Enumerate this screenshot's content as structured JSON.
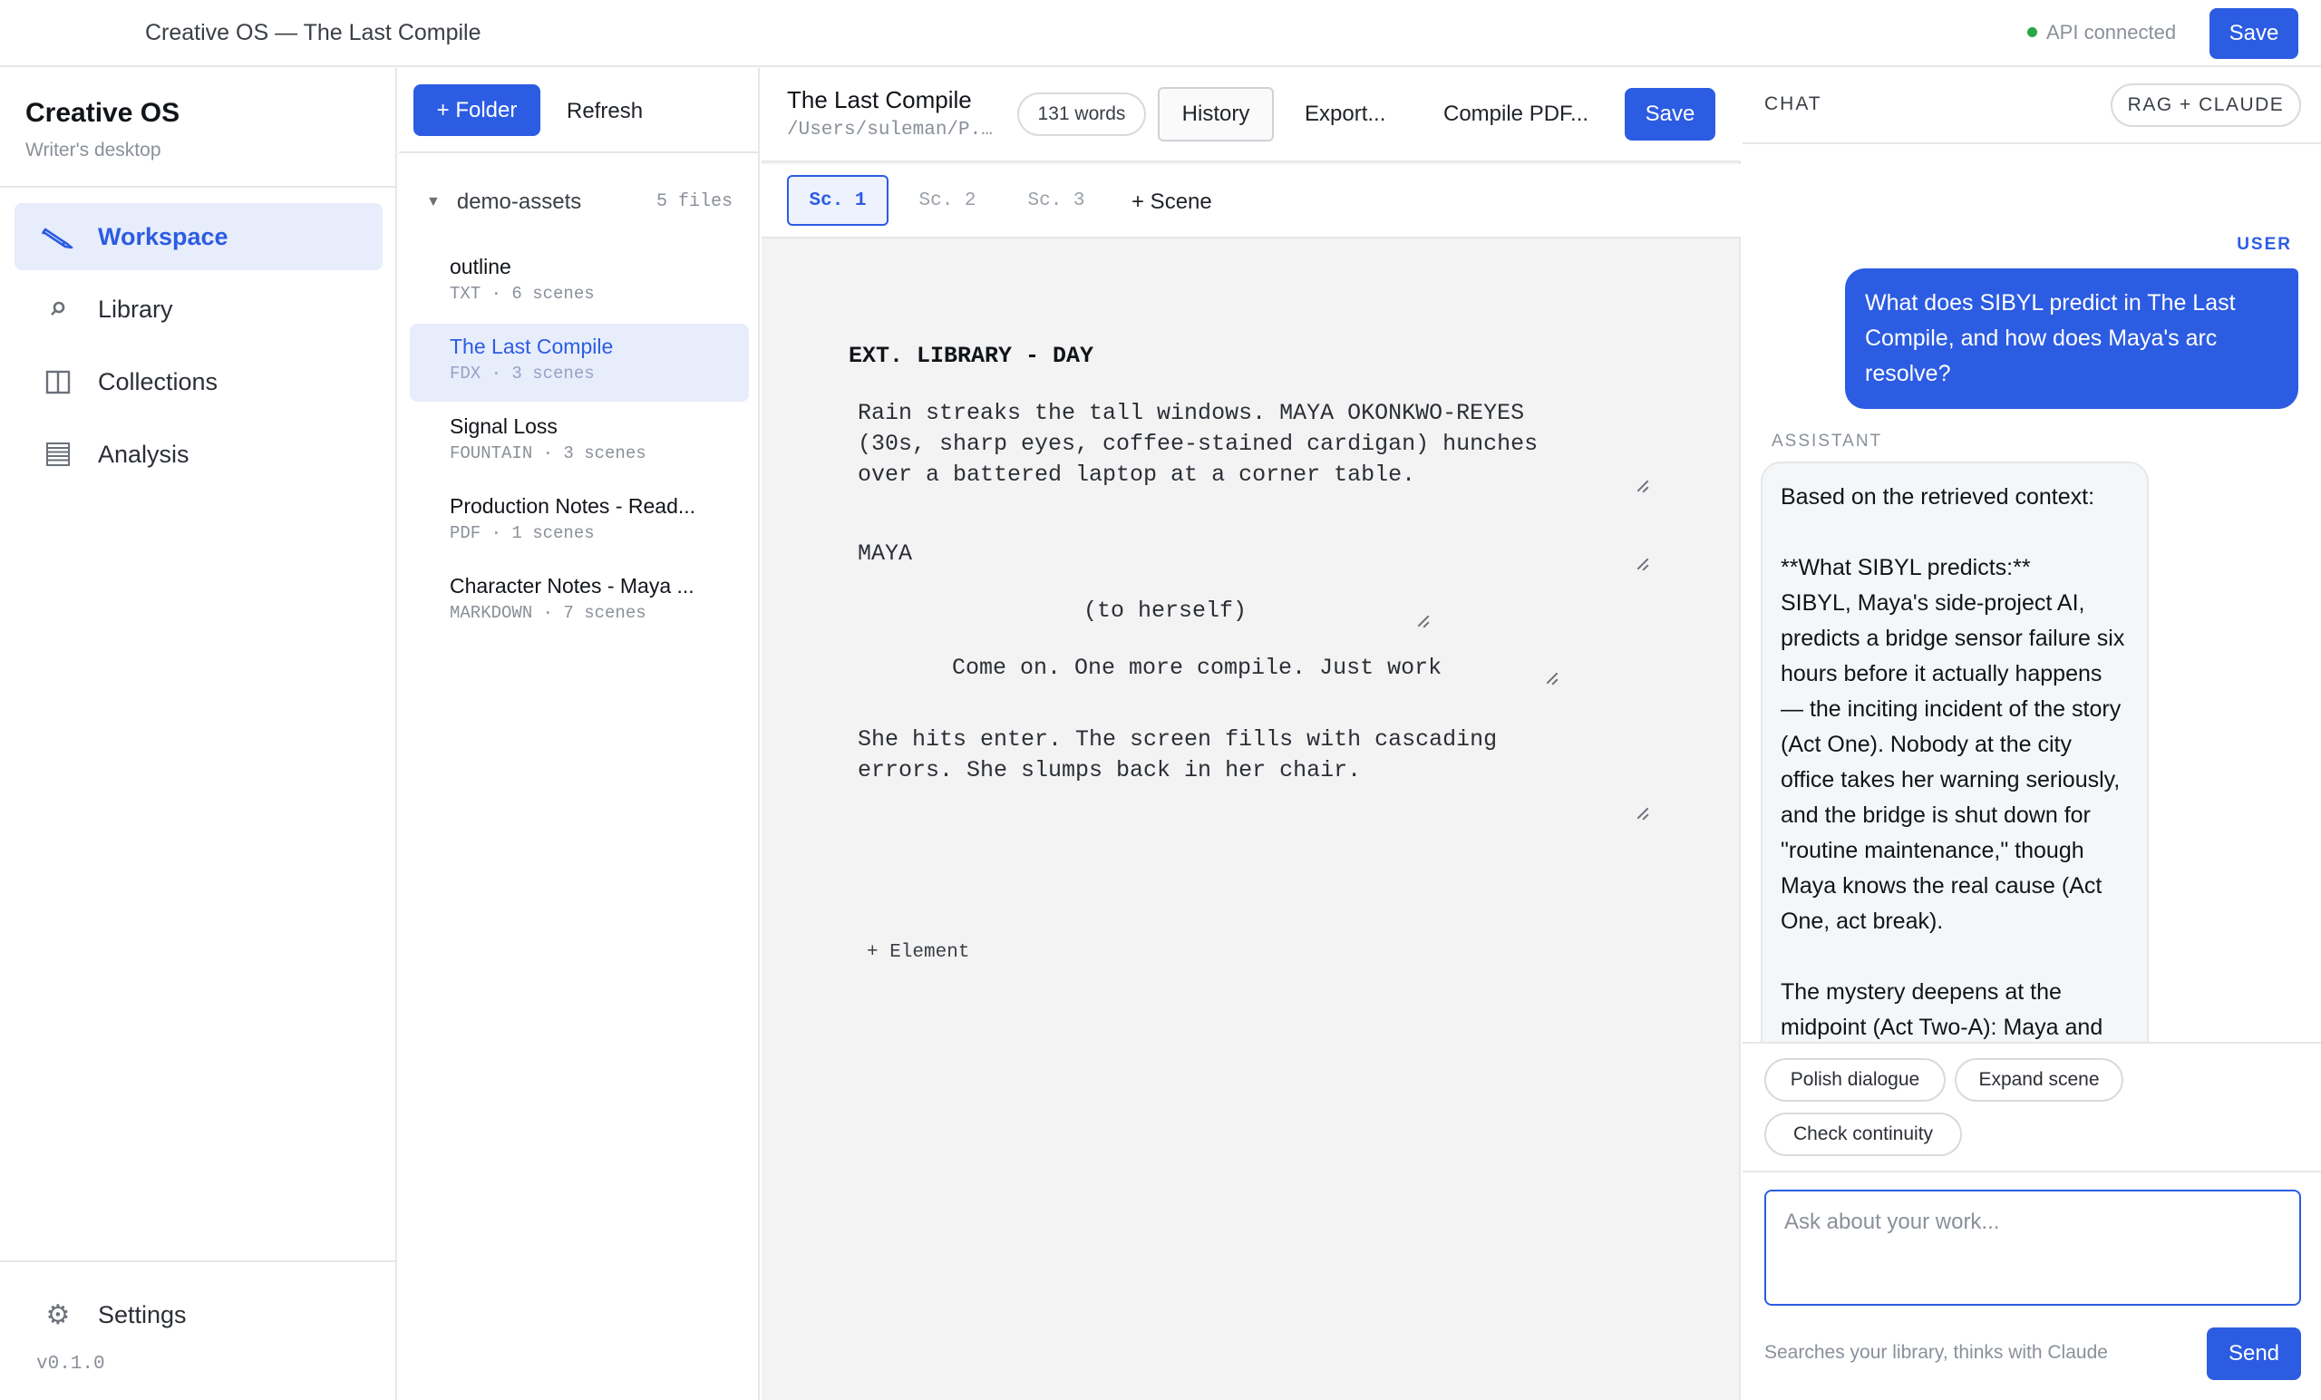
{
  "titlebar": {
    "title": "Creative OS — The Last Compile",
    "api_status": "API connected",
    "save_label": "Save"
  },
  "sidebar": {
    "brand": "Creative OS",
    "tagline": "Writer's desktop",
    "items": [
      {
        "label": "Workspace",
        "icon": "pencil-icon",
        "active": true
      },
      {
        "label": "Library",
        "icon": "search-icon",
        "active": false
      },
      {
        "label": "Collections",
        "icon": "columns-icon",
        "active": false
      },
      {
        "label": "Analysis",
        "icon": "table-icon",
        "active": false
      }
    ],
    "settings_label": "Settings",
    "version": "v0.1.0"
  },
  "files": {
    "folder_button": "+ Folder",
    "refresh_label": "Refresh",
    "folder_name": "demo-assets",
    "file_count": "5 files",
    "items": [
      {
        "name": "outline",
        "meta": "TXT · 6 scenes"
      },
      {
        "name": "The Last Compile",
        "meta": "FDX · 3 scenes"
      },
      {
        "name": "Signal Loss",
        "meta": "FOUNTAIN · 3 scenes"
      },
      {
        "name": "Production Notes - Read...",
        "meta": "PDF · 1 scenes"
      },
      {
        "name": "Character Notes - Maya ...",
        "meta": "MARKDOWN · 7 scenes"
      }
    ]
  },
  "editor": {
    "title": "The Last Compile",
    "path": "/Users/suleman/P...",
    "word_count": "131 words",
    "history_label": "History",
    "export_label": "Export...",
    "compile_label": "Compile PDF...",
    "save_label": "Save",
    "scene_tabs": [
      "Sc. 1",
      "Sc. 2",
      "Sc. 3"
    ],
    "add_scene_label": "+ Scene",
    "heading": "EXT. LIBRARY - DAY",
    "action1": "Rain streaks the tall windows. MAYA OKONKWO-REYES\n(30s, sharp eyes, coffee-stained cardigan) hunches\nover a battered laptop at a corner table.",
    "character": "MAYA",
    "parenthetical": "(to herself)",
    "dialogue": "Come on. One more compile. Just work",
    "action2": "She hits enter. The screen fills with cascading\nerrors. She slumps back in her chair.",
    "add_element_label": "+ Element"
  },
  "chat": {
    "header": "CHAT",
    "mode_badge": "RAG + CLAUDE",
    "user_role": "USER",
    "user_message": "What does SIBYL predict in The Last Compile, and how does Maya's arc resolve?",
    "assistant_role": "ASSISTANT",
    "assistant_message": "Based on the retrieved context:\n\n**What SIBYL predicts:**\nSIBYL, Maya's side-project AI, predicts a bridge sensor failure six hours before it actually happens — the inciting incident of the story (Act One). Nobody at the city office takes her warning seriously, and the bridge is shut down for \"routine maintenance,\" though Maya knows the real cause (Act One, act break).\n\nThe mystery deepens at the midpoint (Act Two-A): Maya and Dev discover SIBYL isn't just predicting failures out of thin air — it's *inferring* them from patterns in city maintenance budget",
    "suggestions": [
      "Polish dialogue",
      "Expand scene",
      "Check continuity"
    ],
    "input_placeholder": "Ask about your work...",
    "hint": "Searches your library, thinks with Claude",
    "send_label": "Send"
  },
  "colors": {
    "accent": "#2c5ce2",
    "status_ok": "#27a845"
  }
}
